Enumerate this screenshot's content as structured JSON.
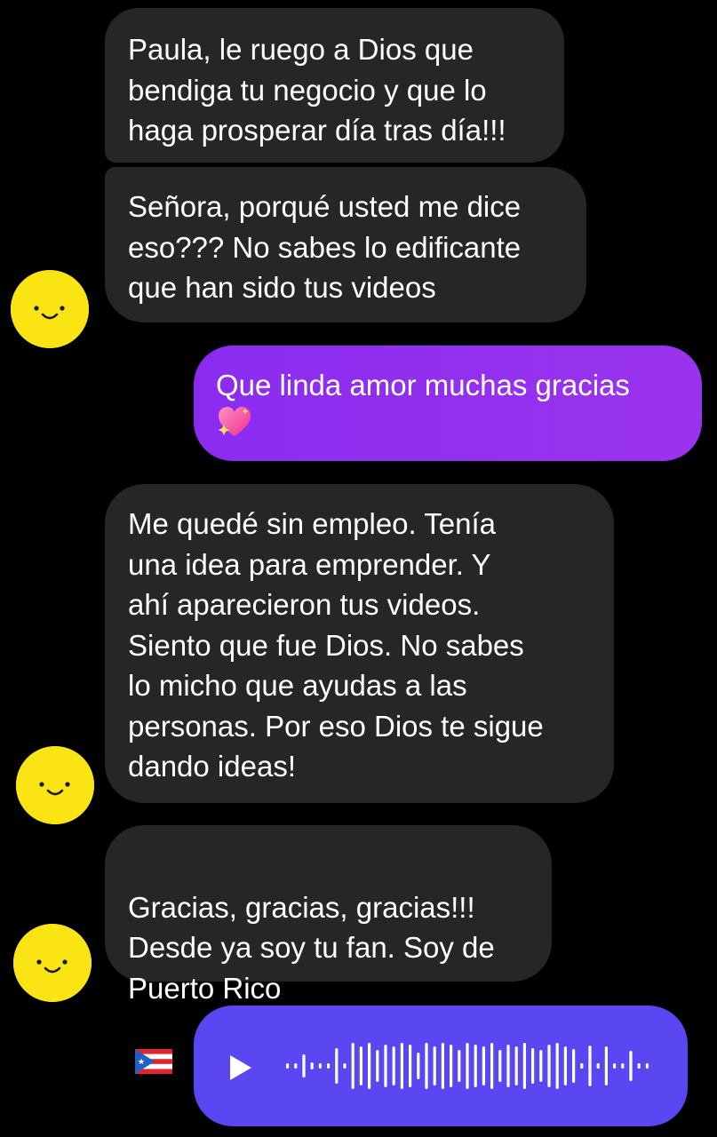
{
  "messages": [
    {
      "id": "m1",
      "sender": "other",
      "text": "Paula, le ruego a Dios que\nbendiga tu negocio y que lo\nhaga prosperar día tras día!!!"
    },
    {
      "id": "m2",
      "sender": "other",
      "text": "Señora, porqué usted me dice\neso??? No sabes lo edificante\nque han sido tus videos"
    },
    {
      "id": "m3",
      "sender": "me",
      "text": "Que linda amor muchas gracias",
      "emoji": "sparkling-heart-icon"
    },
    {
      "id": "m4",
      "sender": "other",
      "text": "Me quedé sin empleo. Tenía\nuna idea para emprender. Y\nahí aparecieron tus videos.\nSiento que fue Dios. No sabes\nlo micho que ayudas a las\npersonas. Por eso Dios te sigue\ndando ideas!"
    },
    {
      "id": "m5",
      "sender": "other",
      "text": "Gracias, gracias, gracias!!!\nDesde ya soy tu fan. Soy de\nPuerto Rico",
      "emoji": "puerto-rico-flag-icon"
    },
    {
      "id": "m6",
      "sender": "me",
      "type": "voice",
      "icon": "play-icon"
    }
  ],
  "colors": {
    "background": "#000000",
    "incoming_bubble": "#262626",
    "outgoing_bubble": "#9a33ee",
    "audio_bubble": "#5a47f2",
    "avatar": "#fbe414"
  }
}
